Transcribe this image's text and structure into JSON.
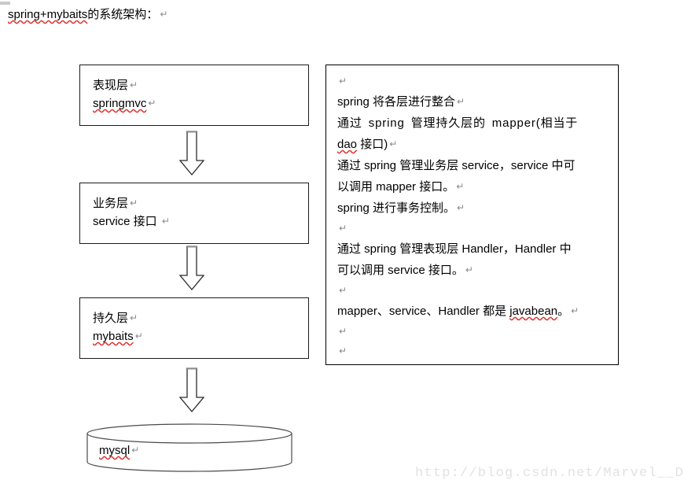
{
  "page": {
    "title_prefix": "spring+mybaits",
    "title_rest": "的系统架构：",
    "pilcrow": "↵"
  },
  "flow": {
    "boxes": [
      {
        "name": "presentation-layer",
        "line1": "表现层",
        "line2": "springmvc",
        "line2_misspelled": true
      },
      {
        "name": "business-layer",
        "line1": "业务层",
        "line2": "service 接口 ",
        "line2_misspelled": false
      },
      {
        "name": "persistence-layer",
        "line1": "持久层",
        "line2": "mybaits",
        "line2_misspelled": true
      }
    ],
    "database": {
      "name": "mysql-database",
      "label": "mysql"
    },
    "arrows": [
      {
        "name": "arrow-presentation-to-business",
        "direction": "down"
      },
      {
        "name": "arrow-business-to-persistence",
        "direction": "down"
      },
      {
        "name": "arrow-persistence-to-database",
        "direction": "down"
      }
    ]
  },
  "notes": {
    "lines": [
      {
        "text": "",
        "blank": true
      },
      {
        "text": "spring 将各层进行整合",
        "blank": false
      },
      {
        "text": "通过 spring 管理持久层的 mapper(相当于",
        "blank": false,
        "justify": true
      },
      {
        "text": "dao 接口)",
        "blank": false,
        "spell": "dao"
      },
      {
        "text": "通过 spring 管理业务层 service，service 中可",
        "blank": false
      },
      {
        "text": "以调用 mapper 接口。",
        "blank": false
      },
      {
        "text": "spring 进行事务控制。",
        "blank": false
      },
      {
        "text": "",
        "blank": true
      },
      {
        "text": "通过 spring 管理表现层 Handler，Handler 中",
        "blank": false
      },
      {
        "text": "可以调用 service 接口。",
        "blank": false
      },
      {
        "text": "",
        "blank": true
      },
      {
        "text": "mapper、service、Handler 都是 javabean。",
        "blank": false,
        "spell": "javabean"
      },
      {
        "text": "",
        "blank": true
      },
      {
        "text": "",
        "blank": true
      }
    ]
  },
  "watermark": {
    "text": "http://blog.csdn.net/Marvel__Dead"
  },
  "colors": {
    "spellcheck_underline": "#e03030",
    "box_border": "#1b1b1b",
    "notes_border": "#000000",
    "arrow_stroke": "#2b2b2b",
    "watermark": "#e2e2e2",
    "pilcrow": "#8a8a8a"
  }
}
